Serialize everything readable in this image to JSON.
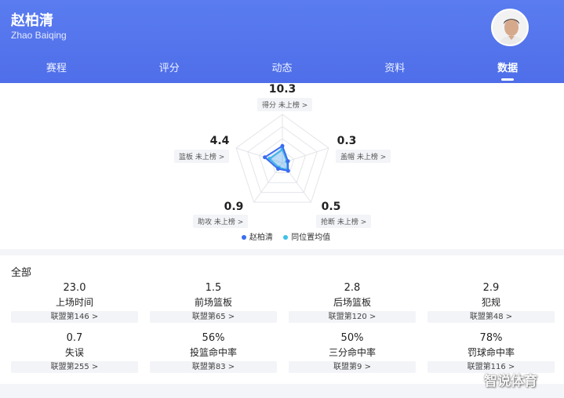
{
  "player": {
    "name_cn": "赵柏清",
    "name_en": "Zhao Baiqing"
  },
  "tabs": [
    "赛程",
    "评分",
    "动态",
    "资料",
    "数据"
  ],
  "active_tab": 4,
  "colors": {
    "header": "#5a7cf0",
    "player_series": "#3b6cf0",
    "peer_series": "#3fc1e6"
  },
  "radar": {
    "points": [
      {
        "value": "10.3",
        "label": "得分 未上榜 >"
      },
      {
        "value": "0.3",
        "label": "盖帽 未上榜 >"
      },
      {
        "value": "0.5",
        "label": "抢断 未上榜 >"
      },
      {
        "value": "0.9",
        "label": "助攻 未上榜 >"
      },
      {
        "value": "4.4",
        "label": "篮板 未上榜 >"
      }
    ],
    "legend": [
      "赵柏清",
      "同位置均值"
    ],
    "player_levels": [
      0.35,
      0.12,
      0.2,
      0.15,
      0.38
    ],
    "peer_levels": [
      0.28,
      0.1,
      0.17,
      0.12,
      0.28
    ]
  },
  "section_title": "全部",
  "stats": [
    {
      "value": "23.0",
      "label": "上场时间",
      "rank": "联盟第146 >"
    },
    {
      "value": "1.5",
      "label": "前场篮板",
      "rank": "联盟第65 >"
    },
    {
      "value": "2.8",
      "label": "后场篮板",
      "rank": "联盟第120 >"
    },
    {
      "value": "2.9",
      "label": "犯规",
      "rank": "联盟第48 >"
    },
    {
      "value": "0.7",
      "label": "失误",
      "rank": "联盟第255 >"
    },
    {
      "value": "56%",
      "label": "投篮命中率",
      "rank": "联盟第83 >"
    },
    {
      "value": "50%",
      "label": "三分命中率",
      "rank": "联盟第9 >"
    },
    {
      "value": "78%",
      "label": "罚球命中率",
      "rank": "联盟第116 >"
    }
  ],
  "watermark": "智说体育"
}
